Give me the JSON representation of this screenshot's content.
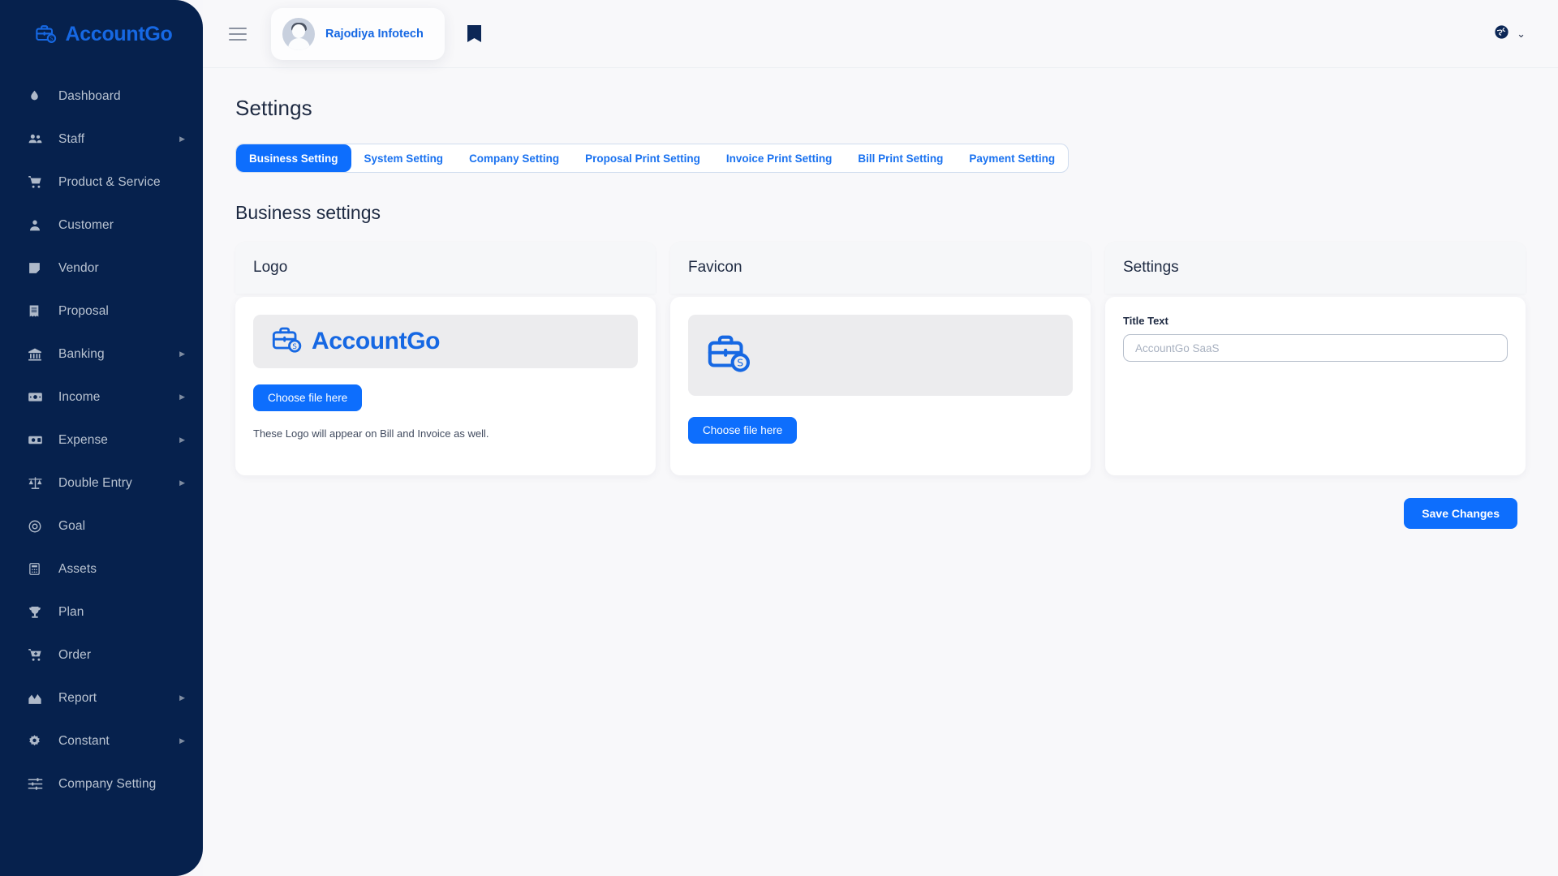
{
  "brand": {
    "name": "AccountGo",
    "icon": "briefcase-dollar-icon",
    "color": "#1668e3"
  },
  "sidebar": {
    "items": [
      {
        "label": "Dashboard",
        "icon": "droplet-icon",
        "has_submenu": false
      },
      {
        "label": "Staff",
        "icon": "users-icon",
        "has_submenu": true
      },
      {
        "label": "Product & Service",
        "icon": "cart-icon",
        "has_submenu": false
      },
      {
        "label": "Customer",
        "icon": "user-badge-icon",
        "has_submenu": false
      },
      {
        "label": "Vendor",
        "icon": "note-icon",
        "has_submenu": false
      },
      {
        "label": "Proposal",
        "icon": "receipt-icon",
        "has_submenu": false
      },
      {
        "label": "Banking",
        "icon": "bank-icon",
        "has_submenu": true
      },
      {
        "label": "Income",
        "icon": "banknote-icon",
        "has_submenu": true
      },
      {
        "label": "Expense",
        "icon": "cash-icon",
        "has_submenu": true
      },
      {
        "label": "Double Entry",
        "icon": "scales-icon",
        "has_submenu": true
      },
      {
        "label": "Goal",
        "icon": "target-icon",
        "has_submenu": false
      },
      {
        "label": "Assets",
        "icon": "calculator-icon",
        "has_submenu": false
      },
      {
        "label": "Plan",
        "icon": "trophy-icon",
        "has_submenu": false
      },
      {
        "label": "Order",
        "icon": "cart-plus-icon",
        "has_submenu": false
      },
      {
        "label": "Report",
        "icon": "bar-chart-icon",
        "has_submenu": true
      },
      {
        "label": "Constant",
        "icon": "gear-icon",
        "has_submenu": true
      },
      {
        "label": "Company Setting",
        "icon": "sliders-icon",
        "has_submenu": false
      }
    ]
  },
  "topbar": {
    "menu_icon": "hamburger-icon",
    "company": "Rajodiya Infotech",
    "avatar_icon": "user-avatar",
    "bookmark_icon": "bookmark-icon",
    "language_icon": "globe-icon",
    "language_caret": "⌄"
  },
  "page": {
    "title": "Settings",
    "section_title": "Business settings"
  },
  "tabs": [
    {
      "label": "Business Setting",
      "active": true
    },
    {
      "label": "System Setting",
      "active": false
    },
    {
      "label": "Company Setting",
      "active": false
    },
    {
      "label": "Proposal Print Setting",
      "active": false
    },
    {
      "label": "Invoice Print Setting",
      "active": false
    },
    {
      "label": "Bill Print Setting",
      "active": false
    },
    {
      "label": "Payment Setting",
      "active": false
    }
  ],
  "cards": {
    "logo": {
      "title": "Logo",
      "preview_text": "AccountGo",
      "preview_icon": "briefcase-dollar-icon",
      "button_label": "Choose file here",
      "helper_text": "These Logo will appear on Bill and Invoice as well."
    },
    "favicon": {
      "title": "Favicon",
      "preview_icon": "briefcase-dollar-icon",
      "button_label": "Choose file here"
    },
    "settings": {
      "title": "Settings",
      "title_text_label": "Title Text",
      "title_text_value": "",
      "title_text_placeholder": "AccountGo SaaS"
    }
  },
  "footer": {
    "save_label": "Save Changes"
  },
  "theme": {
    "sidebar_bg": "#06214d",
    "accent": "#0d6efd",
    "link": "#1668e3",
    "canvas": "#f8f8fa"
  }
}
